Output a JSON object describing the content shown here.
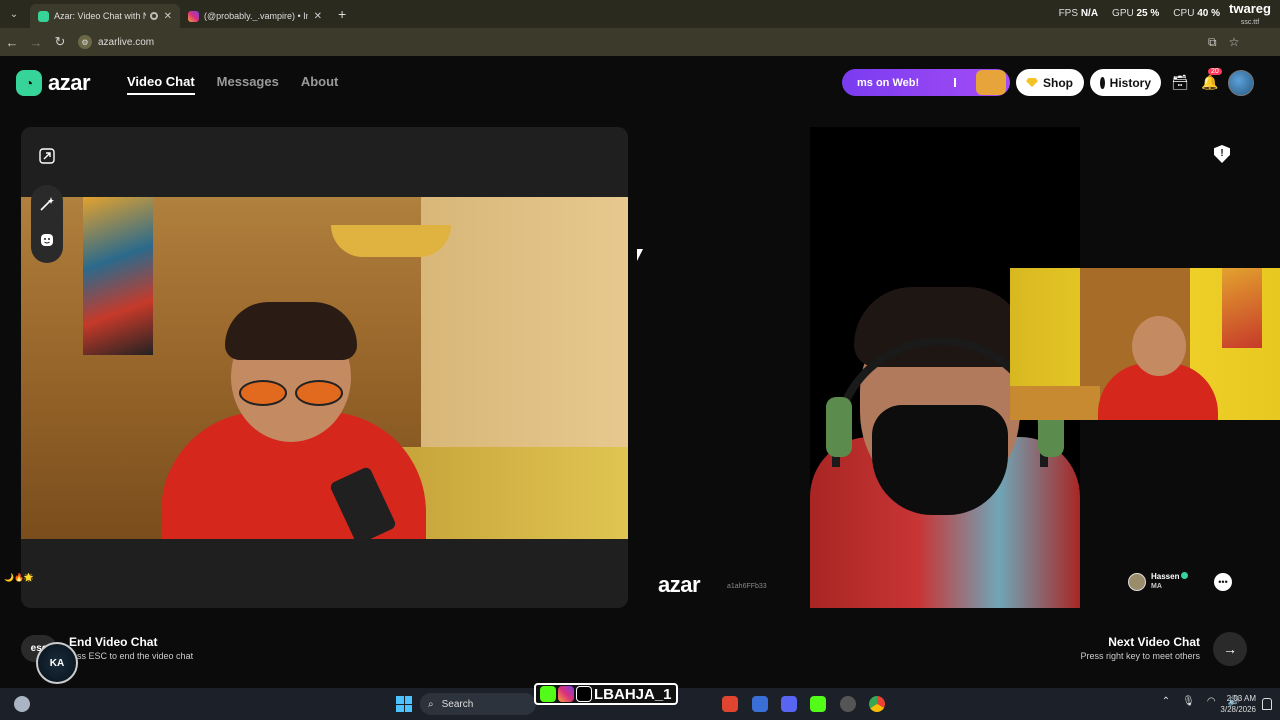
{
  "browser": {
    "tabs": [
      {
        "title": "Azar: Video Chat with New",
        "active": true
      },
      {
        "title": "(@probably._.vampire) • Instag",
        "active": false
      }
    ],
    "new_tab": "+",
    "perf": {
      "fps_label": "FPS",
      "fps_value": "N/A",
      "gpu_label": "GPU",
      "gpu_value": "25 %",
      "cpu_label": "CPU",
      "cpu_value": "40 %"
    },
    "url": "azarlive.com",
    "brand_overlay": "twareg",
    "brand_overlay_sub": "ssc.ttf"
  },
  "site": {
    "logo_text": "azar",
    "nav": [
      {
        "label": "Video Chat",
        "active": true
      },
      {
        "label": "Messages",
        "active": false
      },
      {
        "label": "About",
        "active": false
      }
    ],
    "promo_text": "ms on Web!",
    "shop_label": "Shop",
    "history_label": "History",
    "notification_count": "20"
  },
  "right_panel": {
    "watermark": "azar",
    "session_id": "a1ah6FFb33",
    "partner_name": "Hassen",
    "partner_country": "MA"
  },
  "controls": {
    "esc_key": "esc",
    "end_title": "End Video Chat",
    "end_sub": "ress ESC to end the video chat",
    "next_title": "Next Video Chat",
    "next_sub": "Press right key to meet others"
  },
  "overlay": {
    "handle": "LBAHJA_1",
    "emojis": "🌙🔥🌟"
  },
  "taskbar": {
    "search_label": "Search",
    "time": "2:03 AM",
    "date": "3/28/2026"
  },
  "colors": {
    "accent": "#37d49a",
    "promo": "#8a44f2",
    "badge": "#ff3b5c"
  }
}
